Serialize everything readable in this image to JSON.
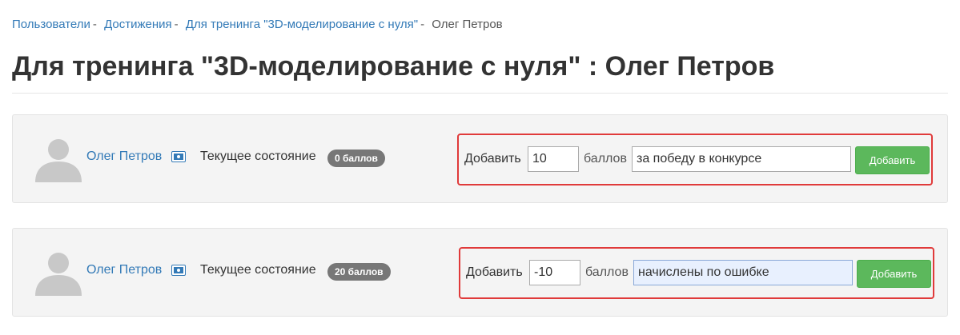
{
  "breadcrumb": {
    "items": [
      "Пользователи",
      "Достижения",
      "Для тренинга \"3D-моделирование с нуля\""
    ],
    "separator": "-",
    "current": "Олег Петров"
  },
  "page": {
    "title": "Для тренинга \"3D-моделирование с нуля\" : Олег Петров"
  },
  "rows": [
    {
      "user_name": "Олег Петров",
      "state_label": "Текущее состояние",
      "badge": "0 баллов",
      "add_label": "Добавить",
      "points_value": "10",
      "points_label": "баллов",
      "reason_value": "за победу в конкурсе",
      "button_label": "Добавить"
    },
    {
      "user_name": "Олег Петров",
      "state_label": "Текущее состояние",
      "badge": "20 баллов",
      "add_label": "Добавить",
      "points_value": "-10",
      "points_label": "баллов",
      "reason_value": "начислены по ошибке",
      "button_label": "Добавить"
    }
  ],
  "colors": {
    "link": "#337ab7",
    "badge": "#777777",
    "button": "#5cb85c",
    "highlight_border": "#e03a3a"
  },
  "icons": [
    "avatar-placeholder-icon",
    "id-card-icon"
  ]
}
